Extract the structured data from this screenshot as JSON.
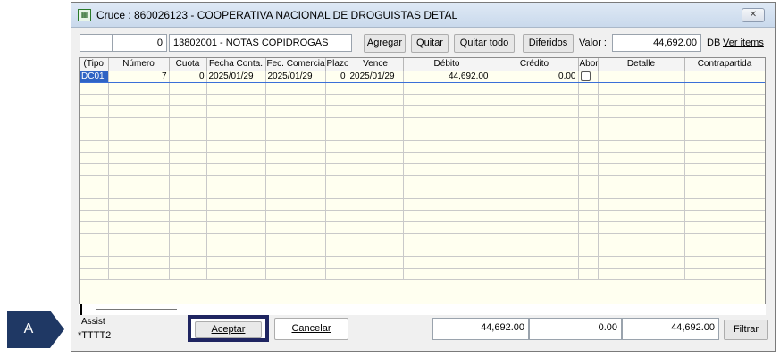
{
  "callout": {
    "letter": "A",
    "color": "#1f3864"
  },
  "window": {
    "title": "Cruce : 860026123 - COOPERATIVA NACIONAL DE DROGUISTAS DETAL",
    "close_symbol": "✕"
  },
  "toolbar": {
    "field_blank": "",
    "field_number": "0",
    "account": "13802001 - NOTAS COPIDROGAS",
    "agregar": "Agregar",
    "quitar": "Quitar",
    "quitar_todo": "Quitar todo",
    "diferidos": "Diferidos",
    "valor_label": "Valor :",
    "valor": "44,692.00",
    "db": "DB",
    "ver_items": "Ver items"
  },
  "grid": {
    "columns": [
      "(Tipo",
      "Número",
      "Cuota",
      "Fecha Conta.",
      "Fec. Comercia",
      "Plazo",
      "Vence",
      "Débito",
      "Crédito",
      "Abor",
      "Detalle",
      "Contrapartida"
    ],
    "rows": [
      {
        "tipo": "DC01",
        "numero": "7",
        "cuota": "0",
        "fecha_conta": "2025/01/29",
        "fec_comercia": "2025/01/29",
        "plazo": "0",
        "vence": "2025/01/29",
        "debito": "44,692.00",
        "credito": "0.00",
        "abono": false,
        "detalle": "",
        "contrapartida": ""
      }
    ]
  },
  "footer": {
    "assist": "Assist",
    "user": "*TTTT2",
    "aceptar": "Aceptar",
    "cancelar": "Cancelar",
    "total_debito": "44,692.00",
    "total_credito": "0.00",
    "total_valor": "44,692.00",
    "filtrar": "Filtrar"
  }
}
